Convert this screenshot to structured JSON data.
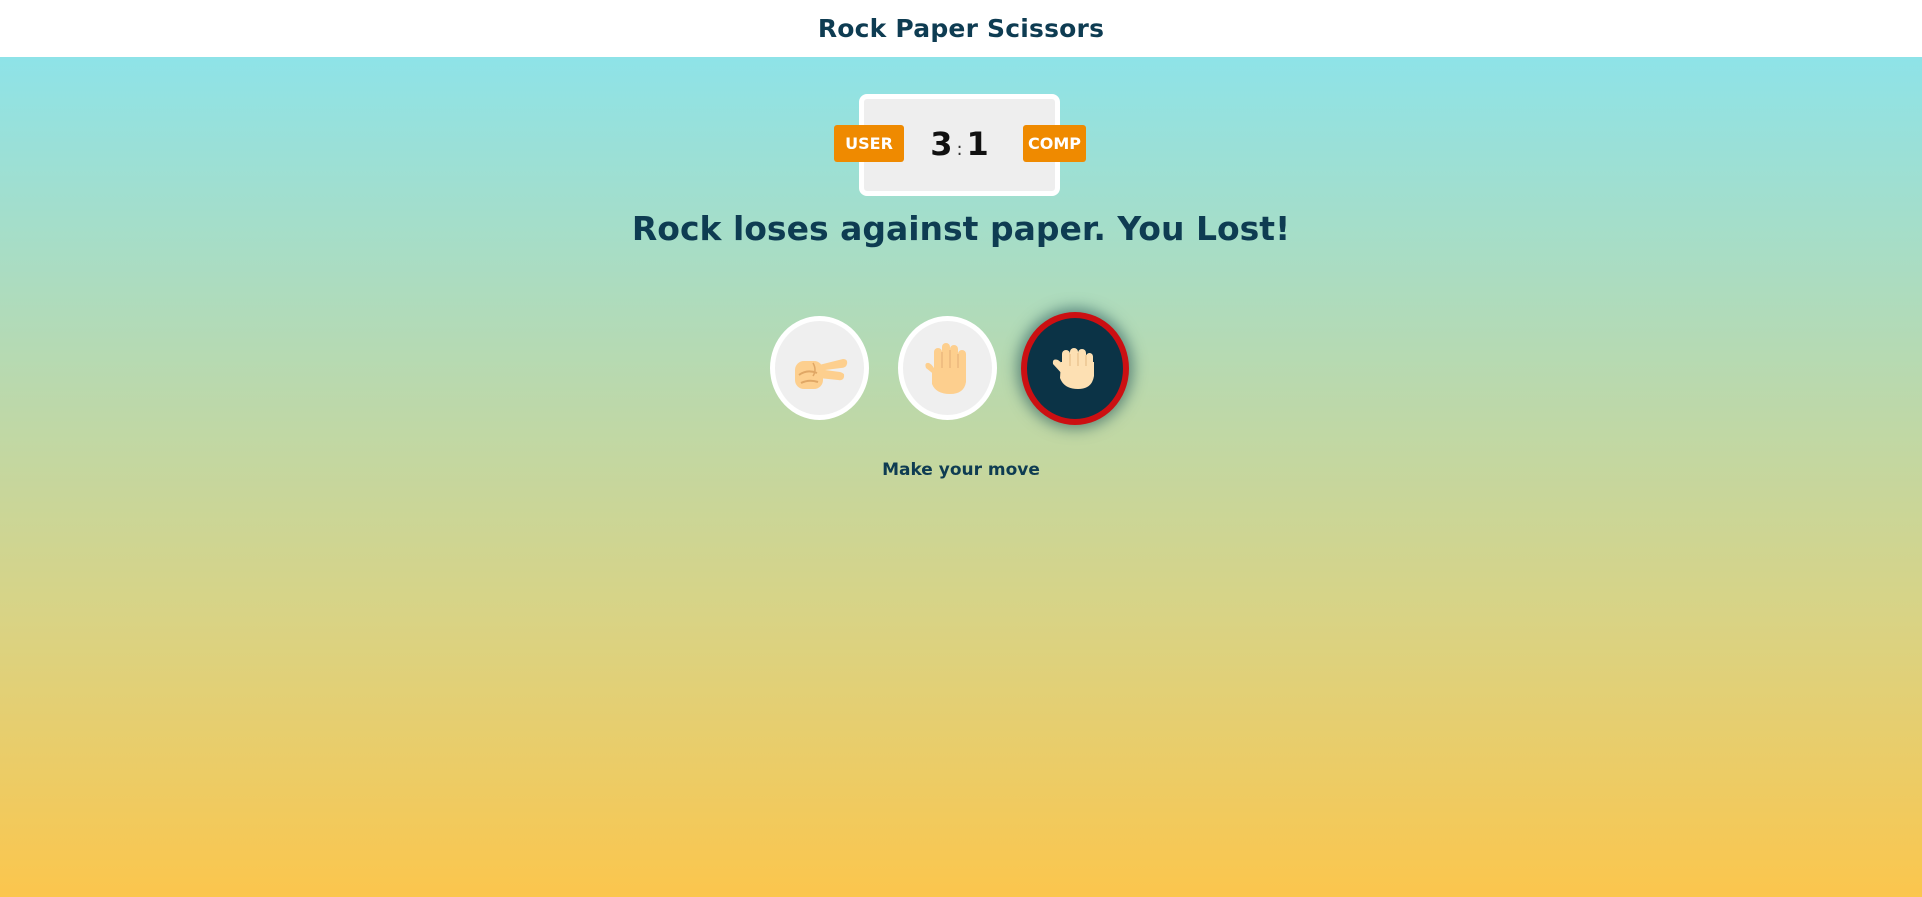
{
  "header": {
    "title": "Rock Paper Scissors"
  },
  "scoreboard": {
    "user_label": "USER",
    "comp_label": "COMP",
    "user_score": "3",
    "separator": ":",
    "comp_score": "1"
  },
  "result_message": "Rock loses against paper. You Lost!",
  "choices": [
    {
      "name": "scissors",
      "icon": "scissors-hand-icon",
      "selected": false
    },
    {
      "name": "paper",
      "icon": "paper-hand-icon",
      "selected": false
    },
    {
      "name": "rock",
      "icon": "rock-fist-icon",
      "selected": true
    }
  ],
  "hint": "Make your move",
  "colors": {
    "accent": "#ef8a00",
    "text": "#0e3c52",
    "selected_border": "#cc0f12",
    "selected_bg": "#0b3346"
  }
}
